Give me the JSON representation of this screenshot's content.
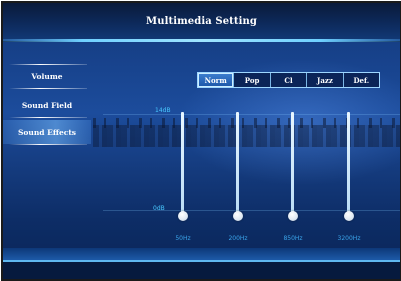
{
  "window": {
    "title": "Multimedia Setting"
  },
  "sidebar": {
    "items": [
      {
        "label": "Volume",
        "selected": false
      },
      {
        "label": "Sound Field",
        "selected": false
      },
      {
        "label": "Sound Effects",
        "selected": true
      }
    ]
  },
  "presets": {
    "tabs": [
      {
        "label": "Norm",
        "active": true
      },
      {
        "label": "Pop",
        "active": false
      },
      {
        "label": "Cl",
        "active": false
      },
      {
        "label": "Jazz",
        "active": false
      },
      {
        "label": "Def.",
        "active": false
      }
    ]
  },
  "equalizer": {
    "max_label": "14dB",
    "min_label": "0dB",
    "bands": [
      {
        "freq": "50Hz",
        "level_db": 0
      },
      {
        "freq": "200Hz",
        "level_db": 0
      },
      {
        "freq": "850Hz",
        "level_db": 0
      },
      {
        "freq": "3200Hz",
        "level_db": 0
      }
    ]
  },
  "colors": {
    "accent": "#48c8ff",
    "background": "#1c4c9c",
    "tab_active": "#2f6fc4"
  }
}
